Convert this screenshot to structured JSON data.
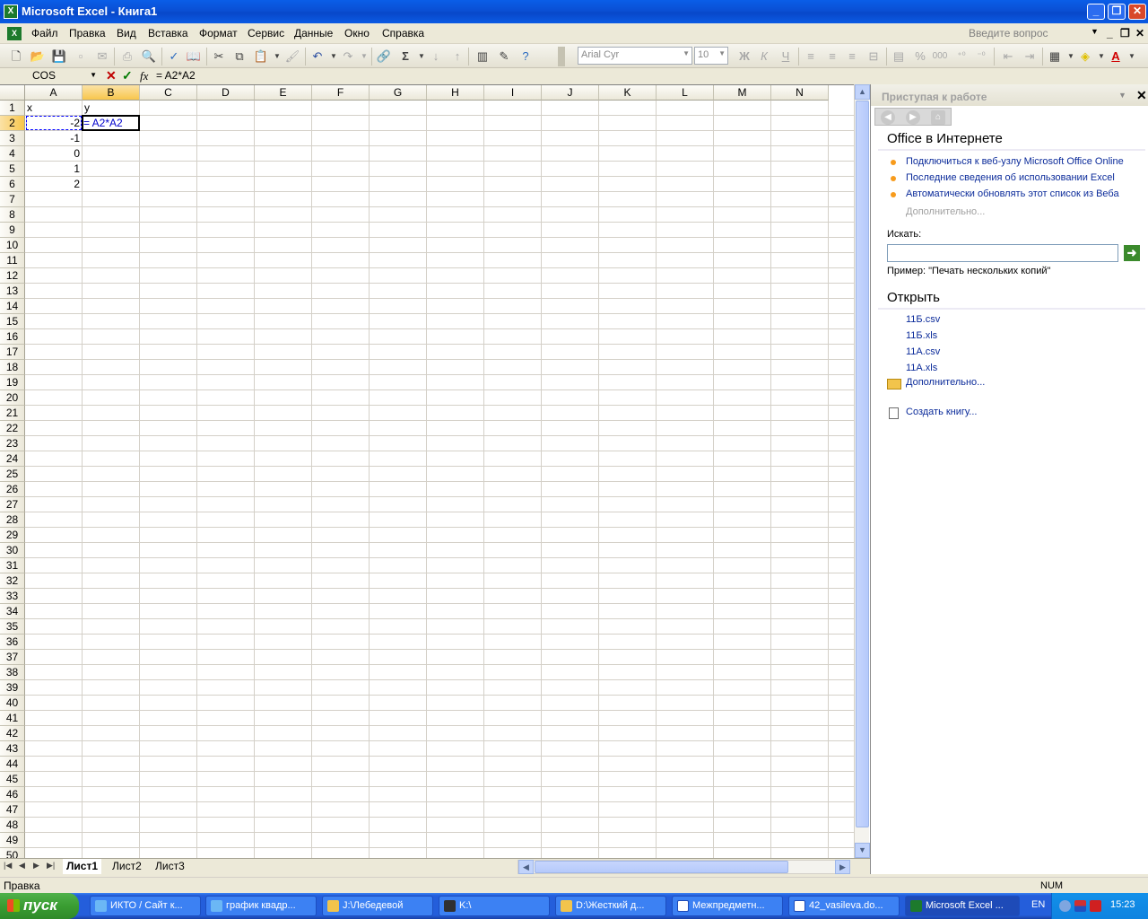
{
  "window": {
    "title": "Microsoft Excel - Книга1"
  },
  "menu": {
    "items": [
      "Файл",
      "Правка",
      "Вид",
      "Вставка",
      "Формат",
      "Сервис",
      "Данные",
      "Окно",
      "Справка"
    ],
    "ask_placeholder": "Введите вопрос"
  },
  "toolbar": {
    "font_name": "Arial Cyr",
    "font_size": "10",
    "bold_label": "Ж",
    "italic_label": "К",
    "underline_label": "Ч",
    "percent_label": "%",
    "thousands_label": "000",
    "sum_label": "Σ"
  },
  "formula_bar": {
    "name_box": "COS",
    "fx_label": "fx",
    "formula": "= A2*A2"
  },
  "grid": {
    "columns": [
      "A",
      "B",
      "C",
      "D",
      "E",
      "F",
      "G",
      "H",
      "I",
      "J",
      "K",
      "L",
      "M",
      "N"
    ],
    "rows": [
      "1",
      "2",
      "3",
      "4",
      "5",
      "6",
      "7",
      "8",
      "9",
      "10",
      "11",
      "12",
      "13",
      "14",
      "15",
      "16",
      "17",
      "18",
      "19",
      "20",
      "21",
      "22",
      "23",
      "24",
      "25",
      "26",
      "27",
      "28",
      "29",
      "30",
      "31",
      "32",
      "33",
      "34",
      "35",
      "36",
      "37",
      "38",
      "39",
      "40",
      "41",
      "42",
      "43",
      "44",
      "45",
      "46",
      "47",
      "48",
      "49",
      "50"
    ],
    "cells": {
      "A1": "x",
      "B1": "y",
      "A2": "-2",
      "B2": "= A2*A2",
      "A3": "-1",
      "A4": "0",
      "A5": "1",
      "A6": "2"
    },
    "active_cell": "B2"
  },
  "sheets": {
    "tabs": [
      "Лист1",
      "Лист2",
      "Лист3"
    ],
    "active": "Лист1"
  },
  "task_pane": {
    "title": "Приступая к работе",
    "online_heading": "Office в Интернете",
    "online_links": [
      "Подключиться к веб-узлу Microsoft Office Online",
      "Последние сведения об использовании Excel",
      "Автоматически обновлять этот список из Веба"
    ],
    "online_more": "Дополнительно...",
    "search_label": "Искать:",
    "search_value": "",
    "example": "Пример:  \"Печать нескольких копий\"",
    "open_heading": "Открыть",
    "files": [
      "11Б.csv",
      "11Б.xls",
      "11А.csv",
      "11А.xls"
    ],
    "open_more": "Дополнительно...",
    "create_book": "Создать книгу..."
  },
  "status": {
    "text": "Правка",
    "num": "NUM"
  },
  "taskbar": {
    "start_label": "пуск",
    "tasks": [
      "ИКТО / Сайт к...",
      "график квадр...",
      "J:\\Лебедевой",
      "K:\\",
      "D:\\Жесткий д...",
      "Межпредметн...",
      "42_vasileva.do...",
      "Microsoft Excel ..."
    ],
    "active_task": "Microsoft Excel ...",
    "language": "EN",
    "clock": "15:23"
  }
}
